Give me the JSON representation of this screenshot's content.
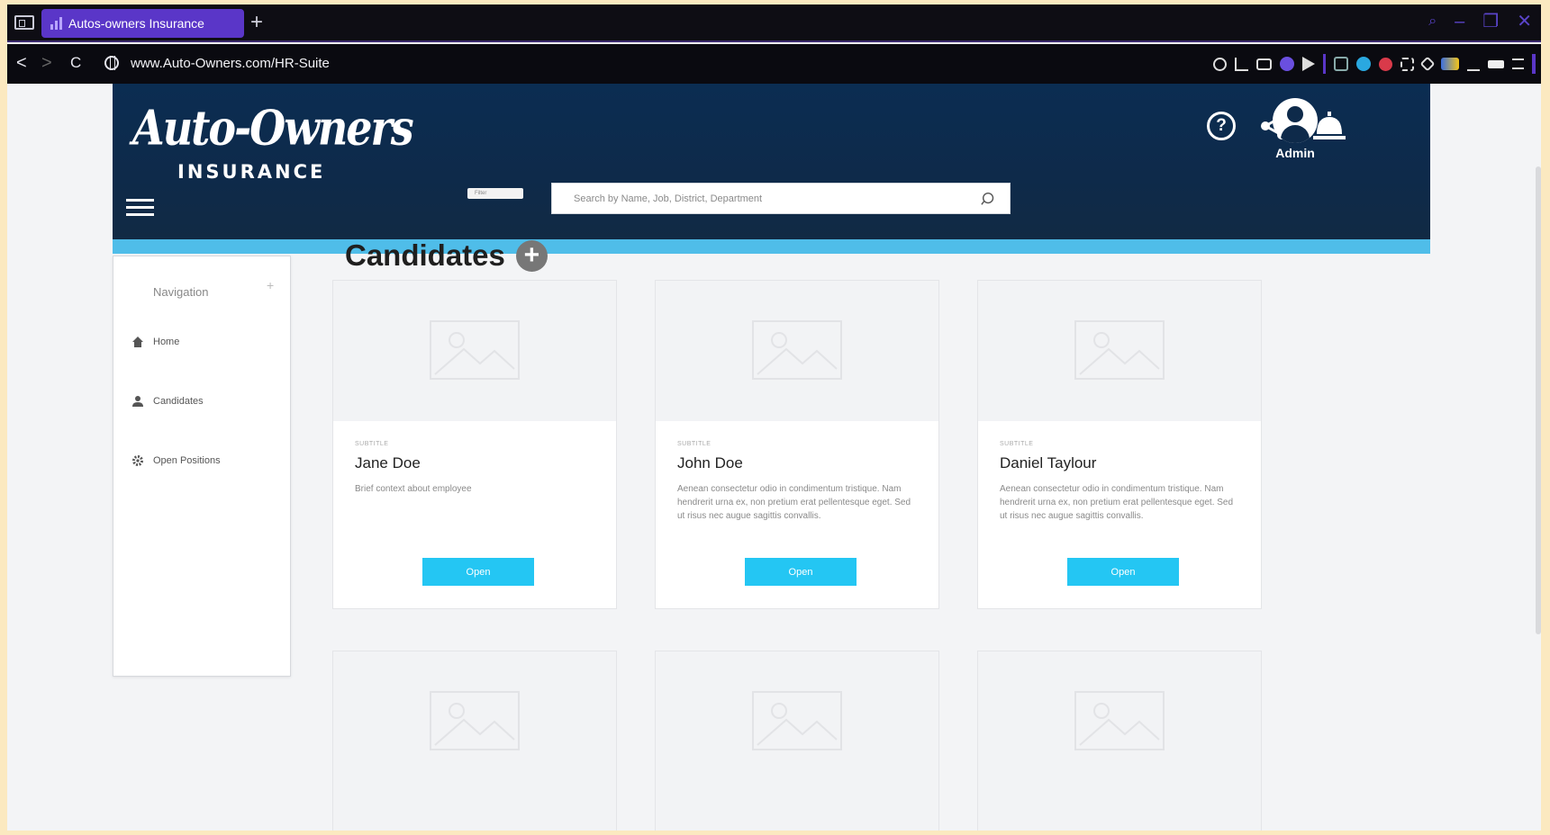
{
  "browser": {
    "tab_title": "Autos-owners Insurance",
    "new_tab": "+",
    "url": "www.Auto-Owners.com/HR-Suite",
    "back": "<",
    "forward": ">",
    "reload": "C",
    "window_controls": [
      "–",
      "❐",
      "✕"
    ]
  },
  "header": {
    "logo_main": "Auto-Owners",
    "logo_sub": "INSURANCE",
    "filter_label": "Filter",
    "search_placeholder": "Search by Name, Job, District, Department",
    "help_glyph": "?",
    "admin_label": "Admin"
  },
  "sidebar": {
    "title": "Navigation",
    "collapse": "+",
    "items": [
      {
        "label": "Home",
        "icon": "home-icon"
      },
      {
        "label": "Candidates",
        "icon": "user-icon"
      },
      {
        "label": "Open Positions",
        "icon": "gear-icon"
      }
    ]
  },
  "main": {
    "title": "Candidates",
    "add_glyph": "+",
    "cards": [
      {
        "subtitle": "SUBTITLE",
        "name": "Jane Doe",
        "description": "Brief context about employee",
        "button": "Open"
      },
      {
        "subtitle": "SUBTITLE",
        "name": "John Doe",
        "description": "Aenean consectetur odio in condimentum tristique. Nam hendrerit urna ex, non pretium erat pellentesque eget. Sed ut risus nec augue sagittis convallis.",
        "button": "Open"
      },
      {
        "subtitle": "SUBTITLE",
        "name": "Daniel Taylour",
        "description": "Aenean consectetur odio in condimentum tristique. Nam hendrerit urna ex, non pretium erat pellentesque eget. Sed ut risus nec augue sagittis convallis.",
        "button": "Open"
      }
    ]
  },
  "colors": {
    "header_bg": "#0e2a4a",
    "accent_strip": "#4fbde9",
    "button": "#24c6f3",
    "tab_active": "#5a36c8"
  }
}
